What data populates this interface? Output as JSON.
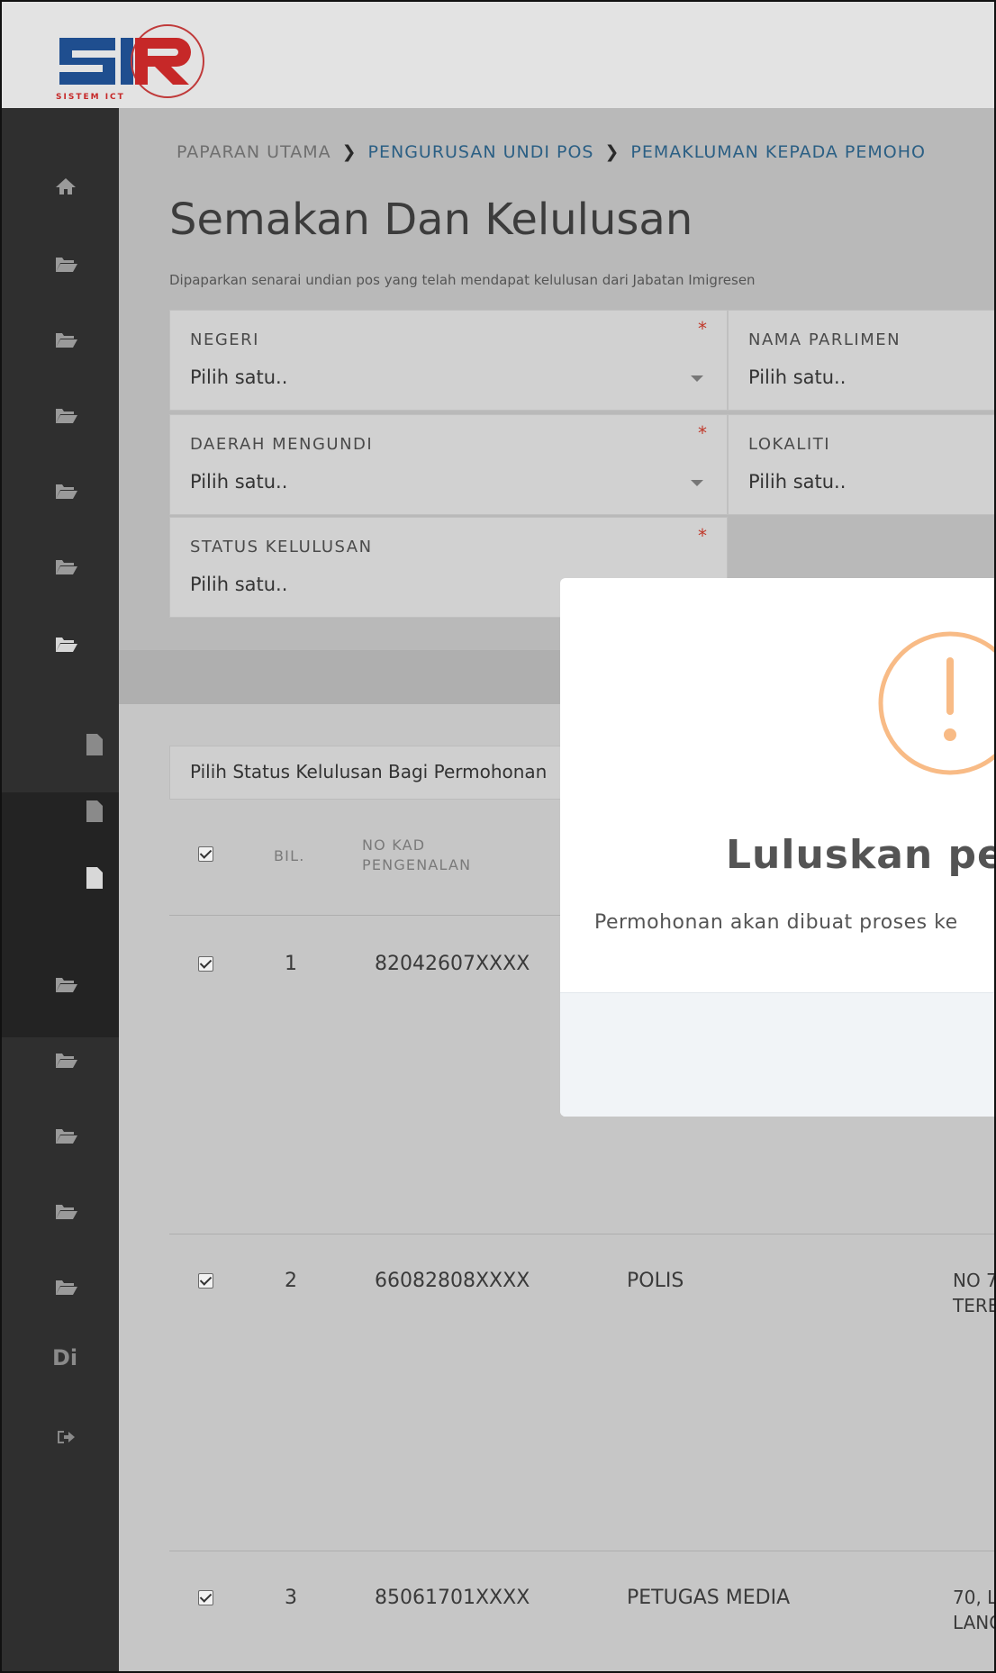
{
  "header": {
    "logo_text": "SISTEM ICT"
  },
  "sidebar": {
    "text_item": "Di"
  },
  "breadcrumb": {
    "home": "PAPARAN UTAMA",
    "level1": "PENGURUSAN UNDI POS",
    "level2": "PEMAKLUMAN KEPADA PEMOHO"
  },
  "page": {
    "title": "Semakan Dan Kelulusan",
    "description": "Dipaparkan senarai undian pos yang telah mendapat kelulusan dari Jabatan Imigresen"
  },
  "form": {
    "negeri_label": "NEGERI",
    "negeri_value": "Pilih satu..",
    "parlimen_label": "NAMA PARLIMEN",
    "parlimen_value": "Pilih satu..",
    "daerah_label": "DAERAH MENGUNDI",
    "daerah_value": "Pilih satu..",
    "lokaliti_label": "LOKALITI",
    "lokaliti_value": "Pilih satu..",
    "status_label": "STATUS KELULUSAN",
    "status_value": "Pilih satu..",
    "required_mark": "*"
  },
  "bulk": {
    "status_select": "Pilih Status Kelulusan Bagi Permohonan"
  },
  "table": {
    "col_bil": "BIL.",
    "col_kad_1": "NO KAD",
    "col_kad_2": "PENGENALAN",
    "rows": [
      {
        "bil": "1",
        "kad": "82042607XXXX",
        "kategori": "",
        "alamat_1": "",
        "alamat_2": ""
      },
      {
        "bil": "2",
        "kad": "66082808XXXX",
        "kategori": "POLIS",
        "alamat_1": "NO 7",
        "alamat_2": "TERE"
      },
      {
        "bil": "3",
        "kad": "85061701XXXX",
        "kategori": "PETUGAS MEDIA",
        "alamat_1": "70, L",
        "alamat_2": "LANG"
      }
    ]
  },
  "modal": {
    "title": "Luluskan perm",
    "text": "Permohonan akan dibuat proses ke"
  },
  "colors": {
    "sidebar": "#2f2f2f",
    "accent_link": "#2b5f84",
    "warning": "#f8bb86",
    "required": "#c0392b"
  }
}
